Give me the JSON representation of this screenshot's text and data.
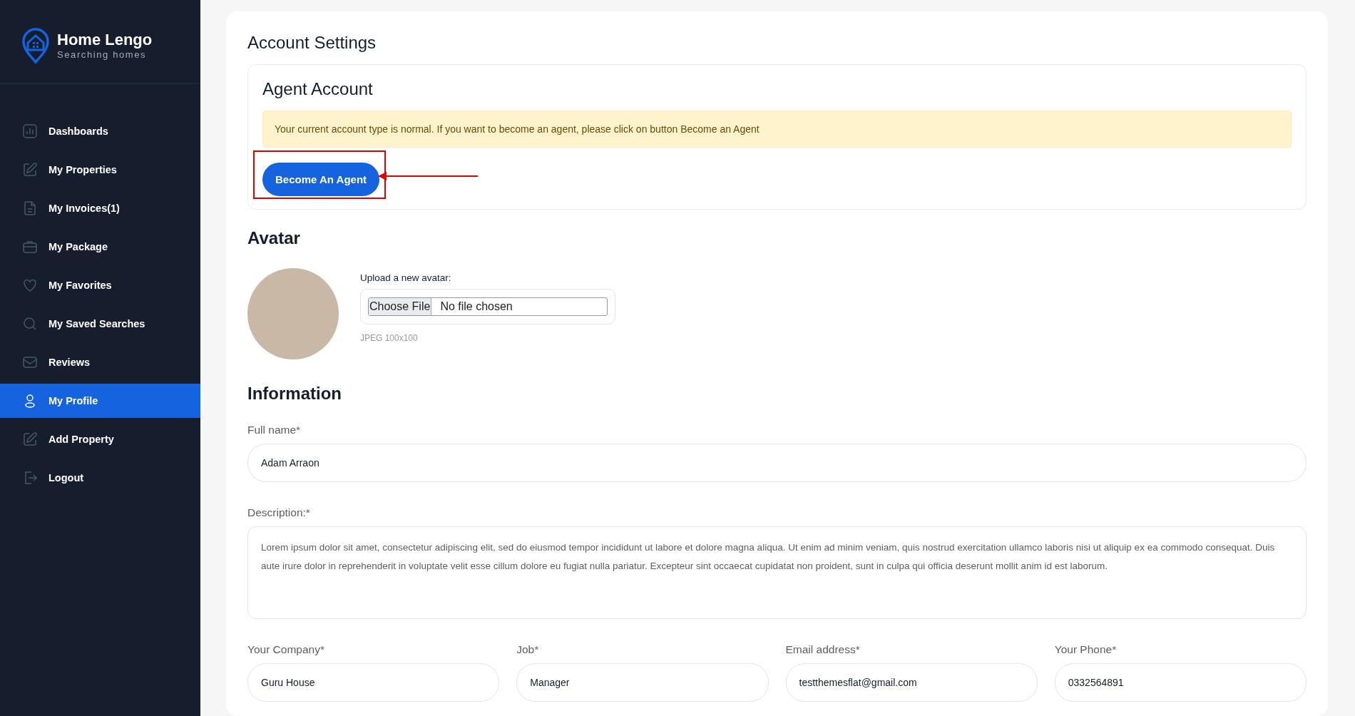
{
  "sidebar": {
    "logo": {
      "title": "Home Lengo",
      "subtitle": "Searching homes"
    },
    "items": [
      {
        "label": "Dashboards",
        "kind": "chart",
        "selected": false
      },
      {
        "label": "My Properties",
        "kind": "edit",
        "selected": false
      },
      {
        "label": "My Invoices(1)",
        "kind": "document",
        "selected": false
      },
      {
        "label": "My Package",
        "kind": "briefcase",
        "selected": false
      },
      {
        "label": "My Favorites",
        "kind": "heart",
        "selected": false
      },
      {
        "label": "My Saved Searches",
        "kind": "search",
        "selected": false
      },
      {
        "label": "Reviews",
        "kind": "mail",
        "selected": false
      },
      {
        "label": "My Profile",
        "kind": "user",
        "selected": true
      },
      {
        "label": "Add Property",
        "kind": "edit",
        "selected": false
      },
      {
        "label": "Logout",
        "kind": "logout",
        "selected": false
      }
    ]
  },
  "page_title": "Account Settings",
  "agent_account": {
    "title": "Agent Account",
    "notice": "Your current account type is normal. If you want to become an agent, please click on button Become an Agent",
    "button": "Become An Agent"
  },
  "avatar": {
    "title": "Avatar",
    "upload_label": "Upload a new avatar:",
    "file_button": "Choose File",
    "file_status": "No file chosen",
    "hint": "JPEG 100x100"
  },
  "information": {
    "title": "Information",
    "fields": [
      {
        "label": "Full name*",
        "value": "Adam Arraon",
        "kind": "input"
      },
      {
        "label": "Description:*",
        "value": "Lorem ipsum dolor sit amet, consectetur adipiscing elit, sed do eiusmod tempor incididunt ut labore et dolore magna aliqua. Ut enim ad minim veniam, quis nostrud exercitation ullamco laboris nisi ut aliquip ex ea commodo consequat. Duis aute irure dolor in reprehenderit in voluptate velit esse cillum dolore eu fugiat nulla pariatur. Excepteur sint occaecat cupidatat non proident, sunt in culpa qui officia deserunt mollit anim id est laborum.",
        "kind": "textarea"
      }
    ],
    "row_fields": [
      {
        "label": "Your Company*",
        "value": "Guru House"
      },
      {
        "label": "Job*",
        "value": "Manager"
      },
      {
        "label": "Email address*",
        "value": "testthemesflat@gmail.com"
      },
      {
        "label": "Your Phone*",
        "value": "0332564891"
      }
    ]
  }
}
